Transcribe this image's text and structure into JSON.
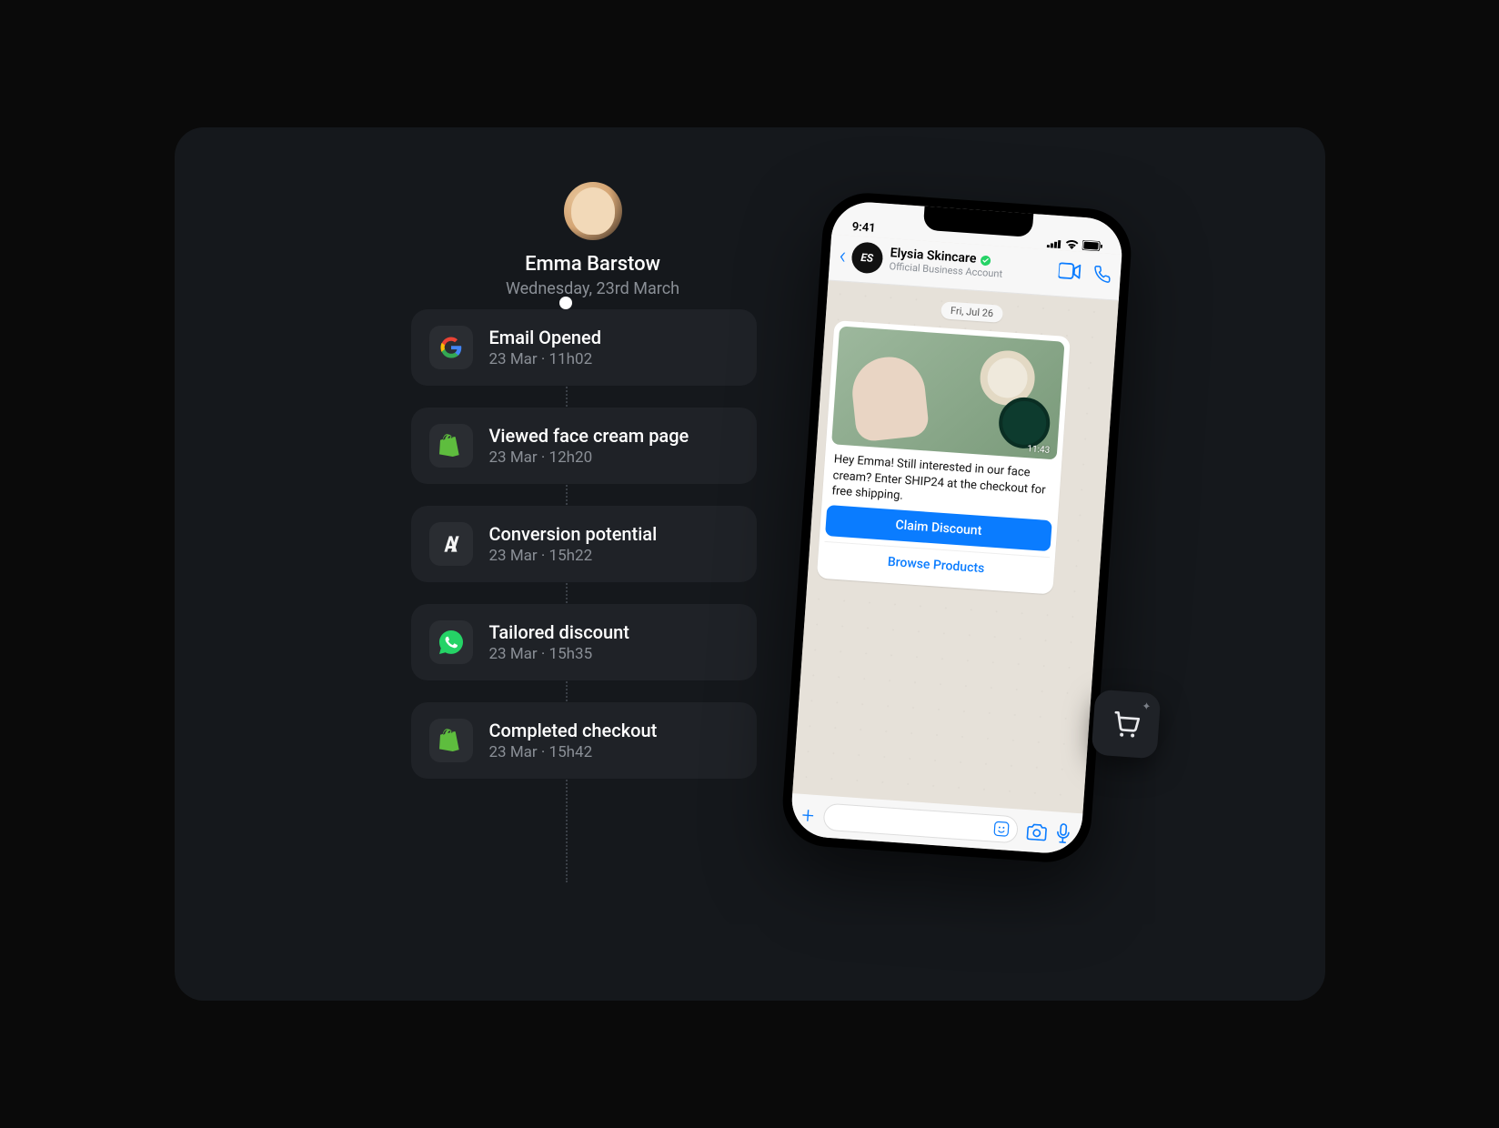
{
  "profile": {
    "name": "Emma Barstow",
    "date": "Wednesday, 23rd March"
  },
  "timeline": [
    {
      "icon": "google",
      "title": "Email Opened",
      "meta": "23 Mar · 11h02"
    },
    {
      "icon": "shopify",
      "title": "Viewed face cream page",
      "meta": "23 Mar · 12h20"
    },
    {
      "icon": "anthropic",
      "title": "Conversion potential",
      "meta": "23 Mar · 15h22"
    },
    {
      "icon": "whatsapp",
      "title": "Tailored discount",
      "meta": "23 Mar · 15h35"
    },
    {
      "icon": "shopify",
      "title": "Completed checkout",
      "meta": "23 Mar · 15h42"
    }
  ],
  "phone": {
    "status_time": "9:41",
    "business_name": "Elysia Skincare",
    "business_sub": "Official Business Account",
    "chat_date": "Fri, Jul 26",
    "msg_time": "11:43",
    "msg_text": "Hey Emma! Still interested in our face cream? Enter SHIP24 at the checkout for free shipping.",
    "btn_primary": "Claim Discount",
    "btn_secondary": "Browse Products"
  }
}
